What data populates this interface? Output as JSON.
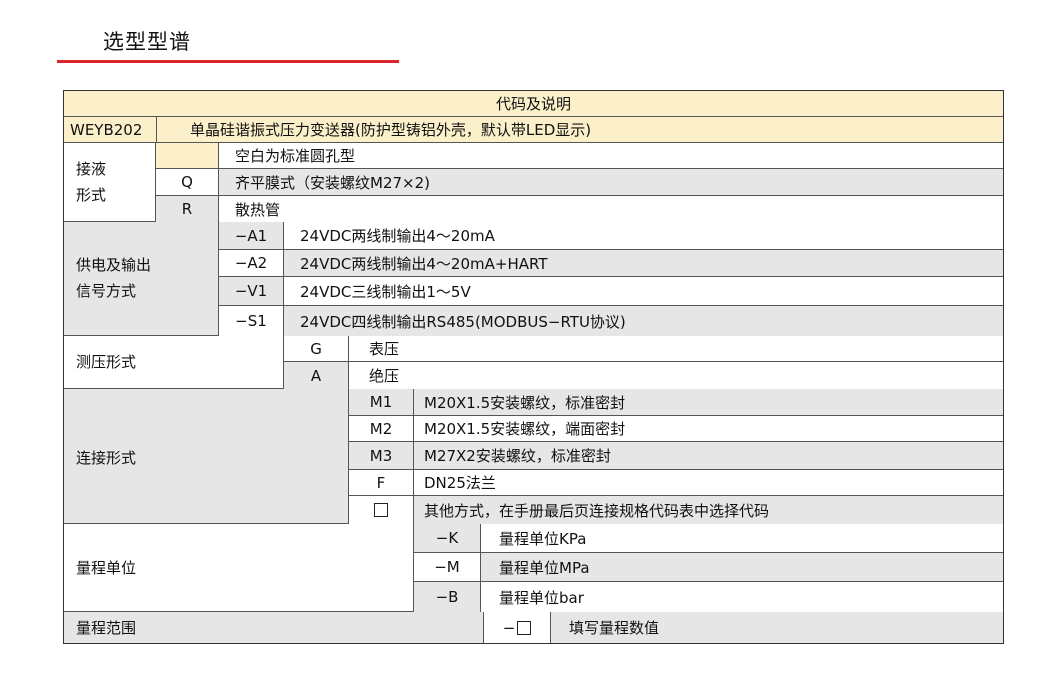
{
  "title": "选型型谱",
  "header": "代码及说明",
  "model": {
    "code": "WEYB202",
    "description": "单晶硅谐振式压力变送器(防护型铸铝外壳，默认带LED显示)"
  },
  "groups": [
    {
      "label": "接液形式",
      "label_lines": [
        "接液",
        "形式"
      ],
      "options": [
        {
          "code": "",
          "desc": "空白为标准圆孔型"
        },
        {
          "code": "Q",
          "desc": "齐平膜式（安装螺纹M27×2)"
        },
        {
          "code": "R",
          "desc": "散热管"
        }
      ]
    },
    {
      "label": "供电及输出信号方式",
      "label_lines": [
        "供电及输出",
        "信号方式"
      ],
      "options": [
        {
          "code": "−A1",
          "desc": "24VDC两线制输出4～20mA"
        },
        {
          "code": "−A2",
          "desc": "24VDC两线制输出4～20mA+HART"
        },
        {
          "code": "−V1",
          "desc": "24VDC三线制输出1～5V"
        },
        {
          "code": "−S1",
          "desc": "24VDC四线制输出RS485(MODBUS−RTU协议)"
        }
      ]
    },
    {
      "label": "测压形式",
      "label_lines": [
        "测压形式"
      ],
      "options": [
        {
          "code": "G",
          "desc": "表压"
        },
        {
          "code": "A",
          "desc": "绝压"
        }
      ]
    },
    {
      "label": "连接形式",
      "label_lines": [
        "连接形式"
      ],
      "options": [
        {
          "code": "M1",
          "desc": "M20X1.5安装螺纹，标准密封"
        },
        {
          "code": "M2",
          "desc": "M20X1.5安装螺纹，端面密封"
        },
        {
          "code": "M3",
          "desc": "M27X2安装螺纹，标准密封"
        },
        {
          "code": "F",
          "desc": "DN25法兰"
        },
        {
          "code": "",
          "desc": "其他方式，在手册最后页连接规格代码表中选择代码",
          "code_icon": "empty-box-icon"
        }
      ]
    },
    {
      "label": "量程单位",
      "label_lines": [
        "量程单位"
      ],
      "options": [
        {
          "code": "−K",
          "desc": "量程单位KPa"
        },
        {
          "code": "−M",
          "desc": "量程单位MPa"
        },
        {
          "code": "−B",
          "desc": "量程单位bar"
        }
      ]
    },
    {
      "label": "量程范围",
      "label_lines": [
        "量程范围"
      ],
      "options": [
        {
          "code": "−",
          "desc": "填写量程数值",
          "code_icon": "empty-box-icon"
        }
      ]
    }
  ],
  "colors": {
    "accent_red": "#d9262b",
    "header_cream": "#fbf0c9",
    "row_gray": "#e6e6e6",
    "border": "#333333"
  }
}
